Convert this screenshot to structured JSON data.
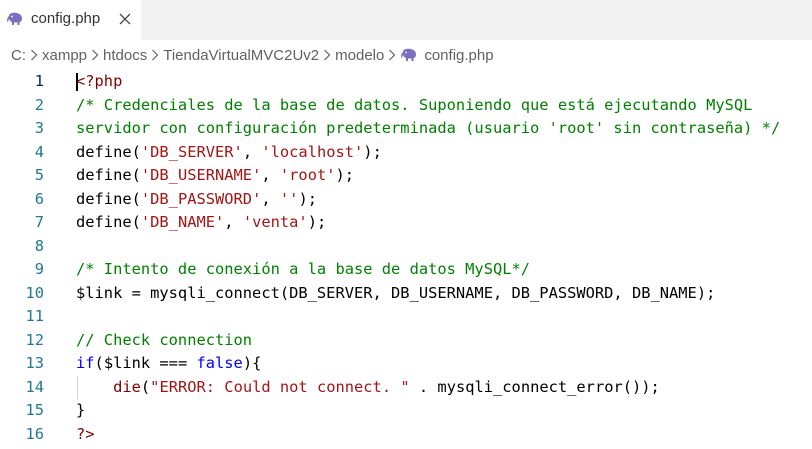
{
  "tab": {
    "label": "config.php",
    "icon": "php-elephant-icon",
    "close_icon": "close-icon"
  },
  "breadcrumb": {
    "items": [
      "C:",
      "xampp",
      "htdocs",
      "TiendaVirtualMVC2Uv2",
      "modelo"
    ],
    "file": "config.php"
  },
  "editor": {
    "active_line": 1,
    "lines": [
      {
        "number": "1",
        "tokens": [
          {
            "t": "tag",
            "v": "<?php"
          }
        ]
      },
      {
        "number": "2",
        "tokens": [
          {
            "t": "comment",
            "v": "/* Credenciales de la base de datos. Suponiendo que está ejecutando MySQL"
          }
        ]
      },
      {
        "number": "3",
        "tokens": [
          {
            "t": "comment",
            "v": "servidor con configuración predeterminada (usuario 'root' sin contraseña) */"
          }
        ]
      },
      {
        "number": "4",
        "tokens": [
          {
            "t": "plain",
            "v": "define("
          },
          {
            "t": "string",
            "v": "'DB_SERVER'"
          },
          {
            "t": "plain",
            "v": ", "
          },
          {
            "t": "string",
            "v": "'localhost'"
          },
          {
            "t": "plain",
            "v": ");"
          }
        ]
      },
      {
        "number": "5",
        "tokens": [
          {
            "t": "plain",
            "v": "define("
          },
          {
            "t": "string",
            "v": "'DB_USERNAME'"
          },
          {
            "t": "plain",
            "v": ", "
          },
          {
            "t": "string",
            "v": "'root'"
          },
          {
            "t": "plain",
            "v": ");"
          }
        ]
      },
      {
        "number": "6",
        "tokens": [
          {
            "t": "plain",
            "v": "define("
          },
          {
            "t": "string",
            "v": "'DB_PASSWORD'"
          },
          {
            "t": "plain",
            "v": ", "
          },
          {
            "t": "string",
            "v": "''"
          },
          {
            "t": "plain",
            "v": ");"
          }
        ]
      },
      {
        "number": "7",
        "tokens": [
          {
            "t": "plain",
            "v": "define("
          },
          {
            "t": "string",
            "v": "'DB_NAME'"
          },
          {
            "t": "plain",
            "v": ", "
          },
          {
            "t": "string",
            "v": "'venta'"
          },
          {
            "t": "plain",
            "v": ");"
          }
        ]
      },
      {
        "number": "8",
        "tokens": []
      },
      {
        "number": "9",
        "tokens": [
          {
            "t": "comment",
            "v": "/* Intento de conexión a la base de datos MySQL*/"
          }
        ]
      },
      {
        "number": "10",
        "tokens": [
          {
            "t": "plain",
            "v": "$link = mysqli_connect(DB_SERVER, DB_USERNAME, DB_PASSWORD, DB_NAME);"
          }
        ]
      },
      {
        "number": "11",
        "tokens": []
      },
      {
        "number": "12",
        "tokens": [
          {
            "t": "comment",
            "v": "// Check connection"
          }
        ]
      },
      {
        "number": "13",
        "tokens": [
          {
            "t": "keyword",
            "v": "if"
          },
          {
            "t": "plain",
            "v": "($link === "
          },
          {
            "t": "keyword",
            "v": "false"
          },
          {
            "t": "plain",
            "v": "){"
          }
        ]
      },
      {
        "number": "14",
        "tokens": [
          {
            "t": "plain",
            "v": "    "
          },
          {
            "t": "tag",
            "v": "die"
          },
          {
            "t": "plain",
            "v": "("
          },
          {
            "t": "string",
            "v": "\"ERROR: Could not connect. \""
          },
          {
            "t": "plain",
            "v": " . mysqli_connect_error());"
          }
        ]
      },
      {
        "number": "15",
        "tokens": [
          {
            "t": "plain",
            "v": "}"
          }
        ]
      },
      {
        "number": "16",
        "tokens": [
          {
            "t": "tag",
            "v": "?>"
          }
        ]
      }
    ]
  },
  "colors": {
    "tag": "#800000",
    "comment": "#008000",
    "string": "#a31515",
    "keyword": "#0000ff",
    "line_number": "#237893",
    "line_number_active": "#0b216f"
  }
}
